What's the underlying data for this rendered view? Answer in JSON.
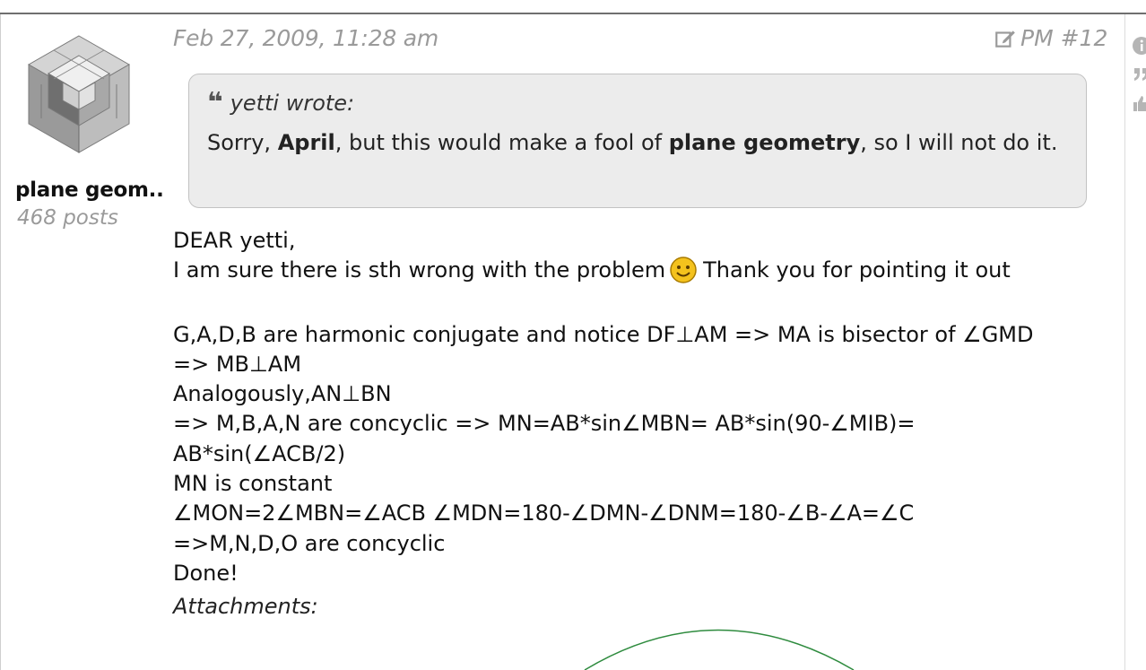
{
  "post": {
    "date": "Feb 27, 2009, 11:28 am",
    "pm_label": "PM #12",
    "author": {
      "name": "plane geom..",
      "posts": "468 posts"
    },
    "quote": {
      "author_line": "yetti wrote:",
      "parts": [
        "Sorry, ",
        "April",
        ", but this would make a fool of ",
        "plane geometry",
        ", so I will not do it."
      ]
    },
    "body": {
      "greeting": "DEAR yetti,",
      "line1_before": "I am sure there is sth wrong with the problem",
      "line1_after": "Thank you for pointing it out",
      "lines": [
        "G,A,D,B are harmonic conjugate and notice DF⊥AM => MA is bisector of ∠GMD",
        "=> MB⊥AM",
        "Analogously,AN⊥BN",
        "=> M,B,A,N are concyclic => MN=AB*sin∠MBN= AB*sin(90-∠MIB)=",
        "AB*sin(∠ACB/2)",
        "MN is constant",
        "∠MON=2∠MBN=∠ACB ∠MDN=180-∠DMN-∠DNM=180-∠B-∠A=∠C",
        "=>M,N,D,O are concyclic",
        "Done!"
      ]
    },
    "attachments_label": "Attachments:"
  },
  "icons": {
    "avatar": "isometric-cube-avatar",
    "pm": "edit-icon",
    "quote": "quote-icon",
    "smiley": "smiley-icon",
    "side": [
      "info-icon",
      "quote-icon",
      "like-icon"
    ]
  },
  "colors": {
    "meta_text": "#9a9a9a",
    "quote_bg": "#ececec",
    "figure_stroke": "#2e8b3e"
  }
}
